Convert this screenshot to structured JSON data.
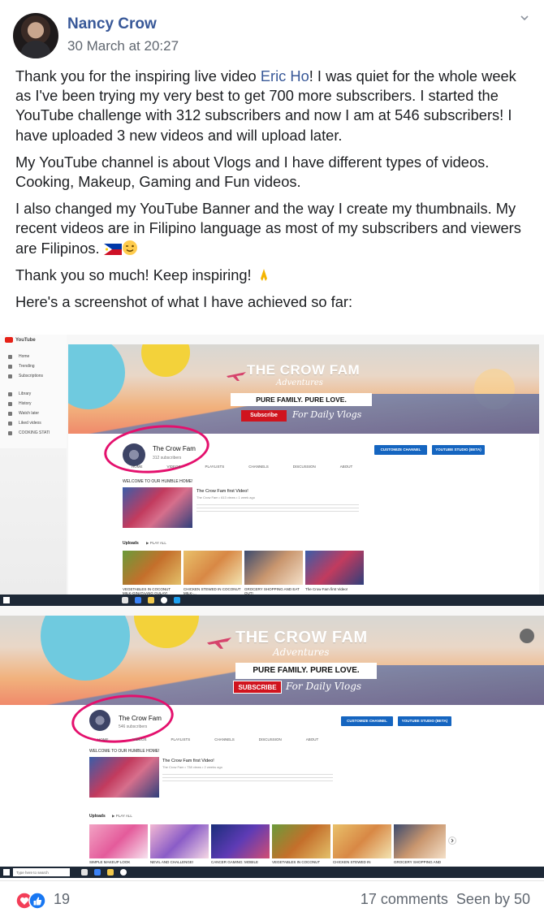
{
  "post": {
    "author": "Nancy Crow",
    "timestamp": "30 March at 20:27",
    "paragraphs": [
      {
        "before": "Thank you for the inspiring live video ",
        "mention": "Eric Ho",
        "after": "! I was quiet for the whole week as I've been trying my very best to get 700 more subscribers. I started the YouTube challenge with 312 subscribers and now I am at 546 subscribers! I have uploaded 3 new videos and will upload later."
      },
      {
        "text": "My YouTube channel is about Vlogs and I have different types of videos. Cooking, Makeup, Gaming and Fun videos."
      },
      {
        "text": "I also changed my YouTube Banner and the way I create my thumbnails. My recent videos are in Filipino language as most of my subscribers and viewers are Filipinos. "
      },
      {
        "text": "Thank you so much! Keep inspiring! "
      },
      {
        "text": "Here's a screenshot of what I have achieved so far:"
      }
    ]
  },
  "screenshot_before": {
    "yt_logo": "YouTube",
    "sidebar": [
      "Home",
      "Trending",
      "Subscriptions",
      "Library",
      "History",
      "Watch later",
      "Liked videos",
      "COOKING STATI"
    ],
    "banner_title": "THE CROW FAM",
    "banner_subtitle": "Adventures",
    "banner_tagline": "PURE FAMILY. PURE LOVE.",
    "subscribe": "Subscribe",
    "daily": "For Daily Vlogs",
    "channel_name": "The Crow Fam",
    "subscribers": "312 subscribers",
    "customize": "CUSTOMIZE CHANNEL",
    "studio": "YOUTUBE STUDIO (BETA)",
    "tabs": [
      "HOME",
      "VIDEOS",
      "PLAYLISTS",
      "CHANNELS",
      "DISCUSSION",
      "ABOUT"
    ],
    "welcome": "WELCOME TO OUR HUMBLE HOME!",
    "featured_title": "The Crow Fam first Video!",
    "featured_meta": "The Crow Fam • 613 views • 1 week ago",
    "uploads": "Uploads",
    "play_all": "PLAY ALL",
    "videos": [
      "VEGETABLES IN COCONUT MILK-GINATAANG GULAY!",
      "CHICKEN STEWED IN COCONUT MILK-...",
      "GROCERY SHOPPING AND EAT OUT!",
      "The Crow Fam first Video!"
    ]
  },
  "screenshot_after": {
    "banner_title": "THE CROW FAM",
    "banner_subtitle": "Adventures",
    "banner_tagline": "PURE FAMILY. PURE LOVE.",
    "subscribe": "SUBSCRIBE",
    "daily": "For Daily Vlogs",
    "channel_name": "The Crow Fam",
    "subscribers": "546 subscribers",
    "customize": "CUSTOMIZE CHANNEL",
    "studio": "YOUTUBE STUDIO (BETA)",
    "tabs": [
      "HOME",
      "VIDEOS",
      "PLAYLISTS",
      "CHANNELS",
      "DISCUSSION",
      "ABOUT"
    ],
    "welcome": "WELCOME TO OUR HUMBLE HOME!",
    "featured_title": "The Crow Fam first Video!",
    "featured_meta": "The Crow Fam • 738 views • 2 weeks ago",
    "uploads": "Uploads",
    "play_all": "PLAY ALL",
    "videos": [
      "SIMPLE MAKEUP LOOK",
      "NEVIL AND CHALLENGE!",
      "CANCER GAMING: MOBILE",
      "VEGETABLES IN COCONUT",
      "CHICKEN STEWED IN",
      "GROCERY SHOPPING AND"
    ],
    "taskbar_search": "Type here to search"
  },
  "footer": {
    "reaction_count": "19",
    "comments": "17 comments",
    "seen_by": "Seen by 50"
  },
  "colors": {
    "link": "#385898",
    "meta": "#606770",
    "like_blue": "#1877f2",
    "love_red": "#f33e58",
    "highlight_pink": "#e4106d"
  }
}
